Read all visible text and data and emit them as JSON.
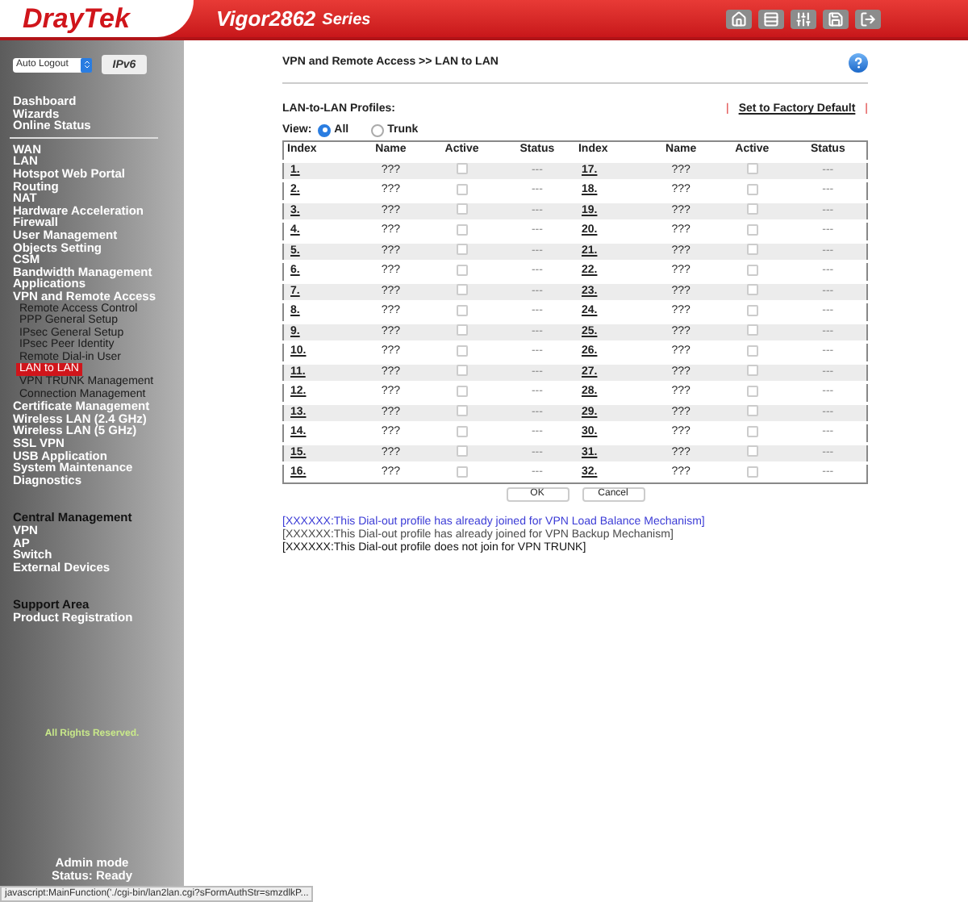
{
  "header": {
    "logo": "DrayTek",
    "model": "Vigor2862",
    "series": "Series"
  },
  "sidebar": {
    "auto_logout": "Auto Logout",
    "ipv6": "IPv6",
    "sections": [
      {
        "items": [
          {
            "label": "Dashboard",
            "kind": "item",
            "selected": false
          },
          {
            "label": "Wizards",
            "kind": "item",
            "selected": false
          },
          {
            "label": "Online Status",
            "kind": "item",
            "selected": false
          }
        ]
      },
      {
        "items": [
          {
            "label": "WAN",
            "kind": "item",
            "selected": false
          },
          {
            "label": "LAN",
            "kind": "item",
            "selected": false
          },
          {
            "label": "Hotspot Web Portal",
            "kind": "item",
            "selected": false
          },
          {
            "label": "Routing",
            "kind": "item",
            "selected": false
          },
          {
            "label": "NAT",
            "kind": "item",
            "selected": false
          },
          {
            "label": "Hardware Acceleration",
            "kind": "item",
            "selected": false
          },
          {
            "label": "Firewall",
            "kind": "item",
            "selected": false
          },
          {
            "label": "User Management",
            "kind": "item",
            "selected": false
          },
          {
            "label": "Objects Setting",
            "kind": "item",
            "selected": false
          },
          {
            "label": "CSM",
            "kind": "item",
            "selected": false
          },
          {
            "label": "Bandwidth Management",
            "kind": "item",
            "selected": false
          },
          {
            "label": "Applications",
            "kind": "item",
            "selected": false
          },
          {
            "label": "VPN and Remote Access",
            "kind": "item",
            "selected": false
          },
          {
            "label": "Remote Access Control",
            "kind": "subitem",
            "selected": false
          },
          {
            "label": "PPP General Setup",
            "kind": "subitem",
            "selected": false
          },
          {
            "label": "IPsec General Setup",
            "kind": "subitem",
            "selected": false
          },
          {
            "label": "IPsec Peer Identity",
            "kind": "subitem",
            "selected": false
          },
          {
            "label": "Remote Dial-in User",
            "kind": "subitem",
            "selected": false
          },
          {
            "label": "LAN to LAN",
            "kind": "subitem",
            "selected": true
          },
          {
            "label": "VPN TRUNK Management",
            "kind": "subitem",
            "selected": false
          },
          {
            "label": "Connection Management",
            "kind": "subitem",
            "selected": false
          },
          {
            "label": "Certificate Management",
            "kind": "item",
            "selected": false
          },
          {
            "label": "Wireless LAN (2.4 GHz)",
            "kind": "item",
            "selected": false
          },
          {
            "label": "Wireless LAN (5 GHz)",
            "kind": "item",
            "selected": false
          },
          {
            "label": "SSL VPN",
            "kind": "item",
            "selected": false
          },
          {
            "label": "USB Application",
            "kind": "item",
            "selected": false
          },
          {
            "label": "System Maintenance",
            "kind": "item",
            "selected": false
          },
          {
            "label": "Diagnostics",
            "kind": "item",
            "selected": false
          }
        ]
      },
      {
        "items": [
          {
            "label": "Central Management",
            "kind": "heading",
            "selected": false
          },
          {
            "label": "VPN",
            "kind": "item",
            "selected": false
          },
          {
            "label": "AP",
            "kind": "item",
            "selected": false
          },
          {
            "label": "Switch",
            "kind": "item",
            "selected": false
          },
          {
            "label": "External Devices",
            "kind": "item",
            "selected": false
          }
        ]
      },
      {
        "items": [
          {
            "label": "Support Area",
            "kind": "heading",
            "selected": false
          },
          {
            "label": "Product Registration",
            "kind": "item",
            "selected": false
          }
        ]
      }
    ],
    "copyright": "All Rights Reserved.",
    "mode": "Admin mode",
    "status": "Status: Ready"
  },
  "page": {
    "breadcrumb": "VPN and Remote Access >> LAN to LAN",
    "profiles_label": "LAN-to-LAN Profiles:",
    "factory_default": "Set to Factory Default",
    "link_separator": "|",
    "view_label": "View:",
    "view_options": [
      {
        "label": "All",
        "selected": true
      },
      {
        "label": "Trunk",
        "selected": false
      }
    ],
    "table": {
      "columns": [
        "Index",
        "Name",
        "Active",
        "Status",
        "Index",
        "Name",
        "Active",
        "Status"
      ],
      "rows": [
        {
          "left": {
            "index": "1.",
            "name": "???",
            "active": false,
            "status": "---"
          },
          "right": {
            "index": "17.",
            "name": "???",
            "active": false,
            "status": "---"
          }
        },
        {
          "left": {
            "index": "2.",
            "name": "???",
            "active": false,
            "status": "---"
          },
          "right": {
            "index": "18.",
            "name": "???",
            "active": false,
            "status": "---"
          }
        },
        {
          "left": {
            "index": "3.",
            "name": "???",
            "active": false,
            "status": "---"
          },
          "right": {
            "index": "19.",
            "name": "???",
            "active": false,
            "status": "---"
          }
        },
        {
          "left": {
            "index": "4.",
            "name": "???",
            "active": false,
            "status": "---"
          },
          "right": {
            "index": "20.",
            "name": "???",
            "active": false,
            "status": "---"
          }
        },
        {
          "left": {
            "index": "5.",
            "name": "???",
            "active": false,
            "status": "---"
          },
          "right": {
            "index": "21.",
            "name": "???",
            "active": false,
            "status": "---"
          }
        },
        {
          "left": {
            "index": "6.",
            "name": "???",
            "active": false,
            "status": "---"
          },
          "right": {
            "index": "22.",
            "name": "???",
            "active": false,
            "status": "---"
          }
        },
        {
          "left": {
            "index": "7.",
            "name": "???",
            "active": false,
            "status": "---"
          },
          "right": {
            "index": "23.",
            "name": "???",
            "active": false,
            "status": "---"
          }
        },
        {
          "left": {
            "index": "8.",
            "name": "???",
            "active": false,
            "status": "---"
          },
          "right": {
            "index": "24.",
            "name": "???",
            "active": false,
            "status": "---"
          }
        },
        {
          "left": {
            "index": "9.",
            "name": "???",
            "active": false,
            "status": "---"
          },
          "right": {
            "index": "25.",
            "name": "???",
            "active": false,
            "status": "---"
          }
        },
        {
          "left": {
            "index": "10.",
            "name": "???",
            "active": false,
            "status": "---"
          },
          "right": {
            "index": "26.",
            "name": "???",
            "active": false,
            "status": "---"
          }
        },
        {
          "left": {
            "index": "11.",
            "name": "???",
            "active": false,
            "status": "---"
          },
          "right": {
            "index": "27.",
            "name": "???",
            "active": false,
            "status": "---"
          }
        },
        {
          "left": {
            "index": "12.",
            "name": "???",
            "active": false,
            "status": "---"
          },
          "right": {
            "index": "28.",
            "name": "???",
            "active": false,
            "status": "---"
          }
        },
        {
          "left": {
            "index": "13.",
            "name": "???",
            "active": false,
            "status": "---"
          },
          "right": {
            "index": "29.",
            "name": "???",
            "active": false,
            "status": "---"
          }
        },
        {
          "left": {
            "index": "14.",
            "name": "???",
            "active": false,
            "status": "---"
          },
          "right": {
            "index": "30.",
            "name": "???",
            "active": false,
            "status": "---"
          }
        },
        {
          "left": {
            "index": "15.",
            "name": "???",
            "active": false,
            "status": "---"
          },
          "right": {
            "index": "31.",
            "name": "???",
            "active": false,
            "status": "---"
          }
        },
        {
          "left": {
            "index": "16.",
            "name": "???",
            "active": false,
            "status": "---"
          },
          "right": {
            "index": "32.",
            "name": "???",
            "active": false,
            "status": "---"
          }
        }
      ]
    },
    "buttons": [
      "OK",
      "Cancel"
    ],
    "notes": [
      {
        "text": "[XXXXXX:This Dial-out profile has already joined for VPN Load Balance Mechanism]",
        "color": "#3b3bd6"
      },
      {
        "text": "[XXXXXX:This Dial-out profile has already joined for VPN Backup Mechanism]",
        "color": "#4a4a4a"
      },
      {
        "text": "[XXXXXX:This Dial-out profile does not join for VPN TRUNK]",
        "color": "#111111"
      }
    ]
  },
  "status_bar": "javascript:MainFunction('./cgi-bin/lan2lan.cgi?sFormAuthStr=smzdlkP..."
}
